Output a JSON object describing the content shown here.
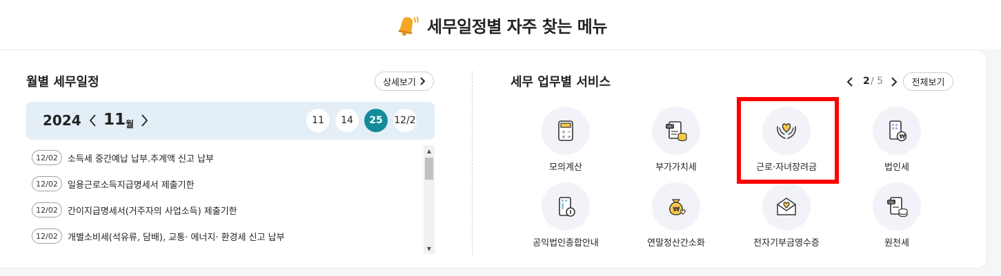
{
  "header": {
    "title": "세무일정별 자주 찾는 메뉴",
    "icon": "bell-icon"
  },
  "left": {
    "title": "월별 세무일정",
    "detail_button": "상세보기",
    "calendar": {
      "year": "2024",
      "month": "11",
      "month_unit": "월",
      "days": [
        "11",
        "14",
        "25",
        "12/2"
      ],
      "active_day": "25"
    },
    "schedule": [
      {
        "date": "12/02",
        "text": "소득세 중간예납 납부.추계액 신고 납부"
      },
      {
        "date": "12/02",
        "text": "일용근로소득지급명세서 제출기한"
      },
      {
        "date": "12/02",
        "text": "간이지급명세서(거주자의 사업소득) 제출기한"
      },
      {
        "date": "12/02",
        "text": "개별소비세(석유류, 담배), 교통· 에너지· 환경세 신고 납부"
      }
    ]
  },
  "right": {
    "title": "세무 업무별 서비스",
    "pager": {
      "current": "2",
      "total_text": "/ 5"
    },
    "all_button": "전체보기",
    "services": [
      {
        "label": "모의계산",
        "icon": "calculator-icon"
      },
      {
        "label": "부가가치세",
        "icon": "vat-document-icon"
      },
      {
        "label": "근로·자녀장려금",
        "icon": "hands-heart-icon"
      },
      {
        "label": "법인세",
        "icon": "corporate-tax-icon"
      },
      {
        "label": "공익법인종합안내",
        "icon": "public-corporation-icon"
      },
      {
        "label": "연말정산간소화",
        "icon": "money-bag-icon"
      },
      {
        "label": "전자기부금영수증",
        "icon": "donation-envelope-icon"
      },
      {
        "label": "원천세",
        "icon": "withholding-tax-icon"
      }
    ]
  },
  "colors": {
    "accent": "#138b9a",
    "calendar_bg": "#e3eef6",
    "highlight": "#ff0000",
    "icon_bg": "#f1f3f8"
  }
}
